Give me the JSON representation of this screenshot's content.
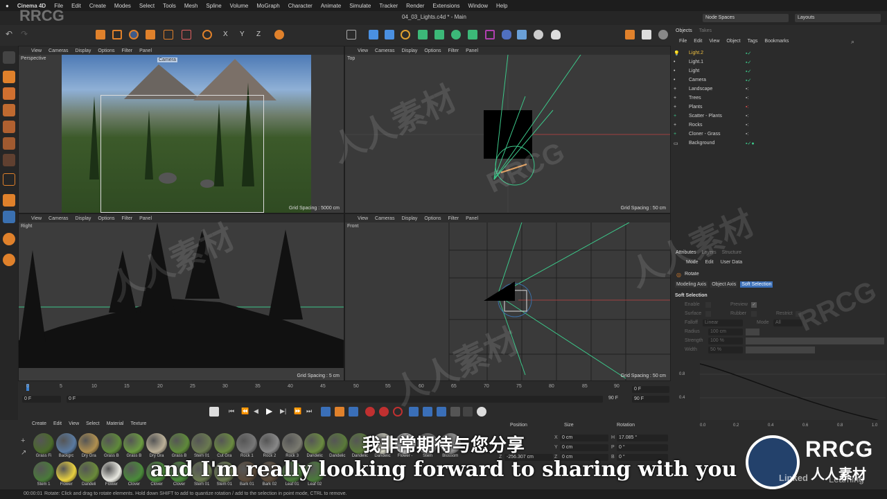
{
  "menubar": {
    "app": "Cinema 4D",
    "items": [
      "File",
      "Edit",
      "Create",
      "Modes",
      "Select",
      "Tools",
      "Mesh",
      "Spline",
      "Volume",
      "MoGraph",
      "Character",
      "Animate",
      "Simulate",
      "Tracker",
      "Render",
      "Extensions",
      "Window",
      "Help"
    ]
  },
  "window": {
    "title": "04_03_Lights.c4d * - Main",
    "node_spaces": "Node Spaces",
    "layouts": "Layouts"
  },
  "viewports": {
    "menu": [
      "View",
      "Cameras",
      "Display",
      "Options",
      "Filter",
      "Panel"
    ],
    "perspective": {
      "label": "Perspective",
      "camera_tag": "Camera",
      "grid": "Grid Spacing : 5000 cm"
    },
    "top": {
      "label": "Top",
      "grid": "Grid Spacing : 50 cm"
    },
    "right": {
      "label": "Right",
      "grid": "Grid Spacing : 5 cm"
    },
    "front": {
      "label": "Front",
      "grid": "Grid Spacing : 50 cm"
    }
  },
  "objects_panel": {
    "tabs": [
      "Objects",
      "Takes"
    ],
    "menu": [
      "File",
      "Edit",
      "View",
      "Object",
      "Tags",
      "Bookmarks"
    ],
    "items": [
      "Light.2",
      "Light.1",
      "Light",
      "Camera",
      "Landscape",
      "Trees",
      "Plants",
      "Scatter - Plants",
      "Rocks",
      "Cloner - Grass",
      "Background"
    ]
  },
  "attributes_panel": {
    "tabs": [
      "Attributes",
      "Layers",
      "Structure"
    ],
    "menu": [
      "Mode",
      "Edit",
      "User Data"
    ],
    "tool": "Rotate",
    "subtabs": [
      "Modeling Axis",
      "Object Axis",
      "Soft Selection"
    ],
    "section": "Soft Selection",
    "fields": {
      "enable": "Enable",
      "preview": "Preview",
      "surface": "Surface",
      "rubber": "Rubber",
      "restrict": "Restrict",
      "falloff": "Falloff",
      "falloff_value": "Linear",
      "mode": "Mode",
      "mode_value": "All",
      "radius": "Radius",
      "radius_value": "100 cm",
      "strength": "Strength",
      "strength_value": "100 %",
      "width": "Width",
      "width_value": "50 %"
    },
    "graph_y": [
      "0.8",
      "0.4"
    ],
    "graph_x": [
      "0.0",
      "0.2",
      "0.4",
      "0.6",
      "0.8",
      "1.0"
    ]
  },
  "timeline": {
    "ticks": [
      "0",
      "5",
      "10",
      "15",
      "20",
      "25",
      "30",
      "35",
      "40",
      "45",
      "50",
      "55",
      "60",
      "65",
      "70",
      "75",
      "80",
      "85",
      "90"
    ],
    "start": "0 F",
    "current": "0 F",
    "end": "90 F",
    "end2": "90 F",
    "right_frame": "0 F"
  },
  "materials": {
    "menu": [
      "Create",
      "Edit",
      "View",
      "Select",
      "Material",
      "Texture"
    ],
    "row1": [
      "Grass Fi",
      "Backgrc",
      "Dry Gra",
      "Grass B",
      "Grass B",
      "Dry Gra",
      "Grass B",
      "Stem 01",
      "Cut Gra",
      "Rock 1",
      "Rock 2",
      "Rock 3",
      "Dandelic",
      "Dandelic",
      "Dandelic",
      "Dandelic",
      "Flower -",
      "Stem",
      "Blossom"
    ],
    "row2": [
      "Stem 1",
      "Flower",
      "Dandeli",
      "Flower",
      "Clover",
      "Clover",
      "Clover",
      "Stem 01",
      "Stem 01",
      "Bark 01",
      "Bark 02",
      "Leaf 01",
      "Leaf 02"
    ]
  },
  "coords": {
    "headers": [
      "Position",
      "Size",
      "Rotation"
    ],
    "rows": [
      {
        "pos_axis": "X",
        "pos": "0 cm",
        "size_axis": "X",
        "size": "0 cm",
        "rot_axis": "H",
        "rot": "17.085 °"
      },
      {
        "pos_axis": "Y",
        "pos": "0 cm",
        "size_axis": "Y",
        "size": "0 cm",
        "rot_axis": "P",
        "rot": "0 °"
      },
      {
        "pos_axis": "Z",
        "pos": "-256.307 cm",
        "size_axis": "Z",
        "size": "0 cm",
        "rot_axis": "B",
        "rot": "0 °"
      }
    ]
  },
  "status": {
    "time": "00:00:01",
    "message": "Rotate: Click and drag to rotate elements. Hold down SHIFT to add to quantize rotation / add to the selection in point mode, CTRL to remove."
  },
  "subtitles": {
    "cn": "我非常期待与您分享",
    "en": "and I'm really looking forward to sharing with you"
  },
  "watermarks": {
    "rrcg": "RRCG",
    "cn": "人人素材",
    "brand_cn": "人人素材",
    "linked": "Linked",
    "learning": "Learning"
  }
}
